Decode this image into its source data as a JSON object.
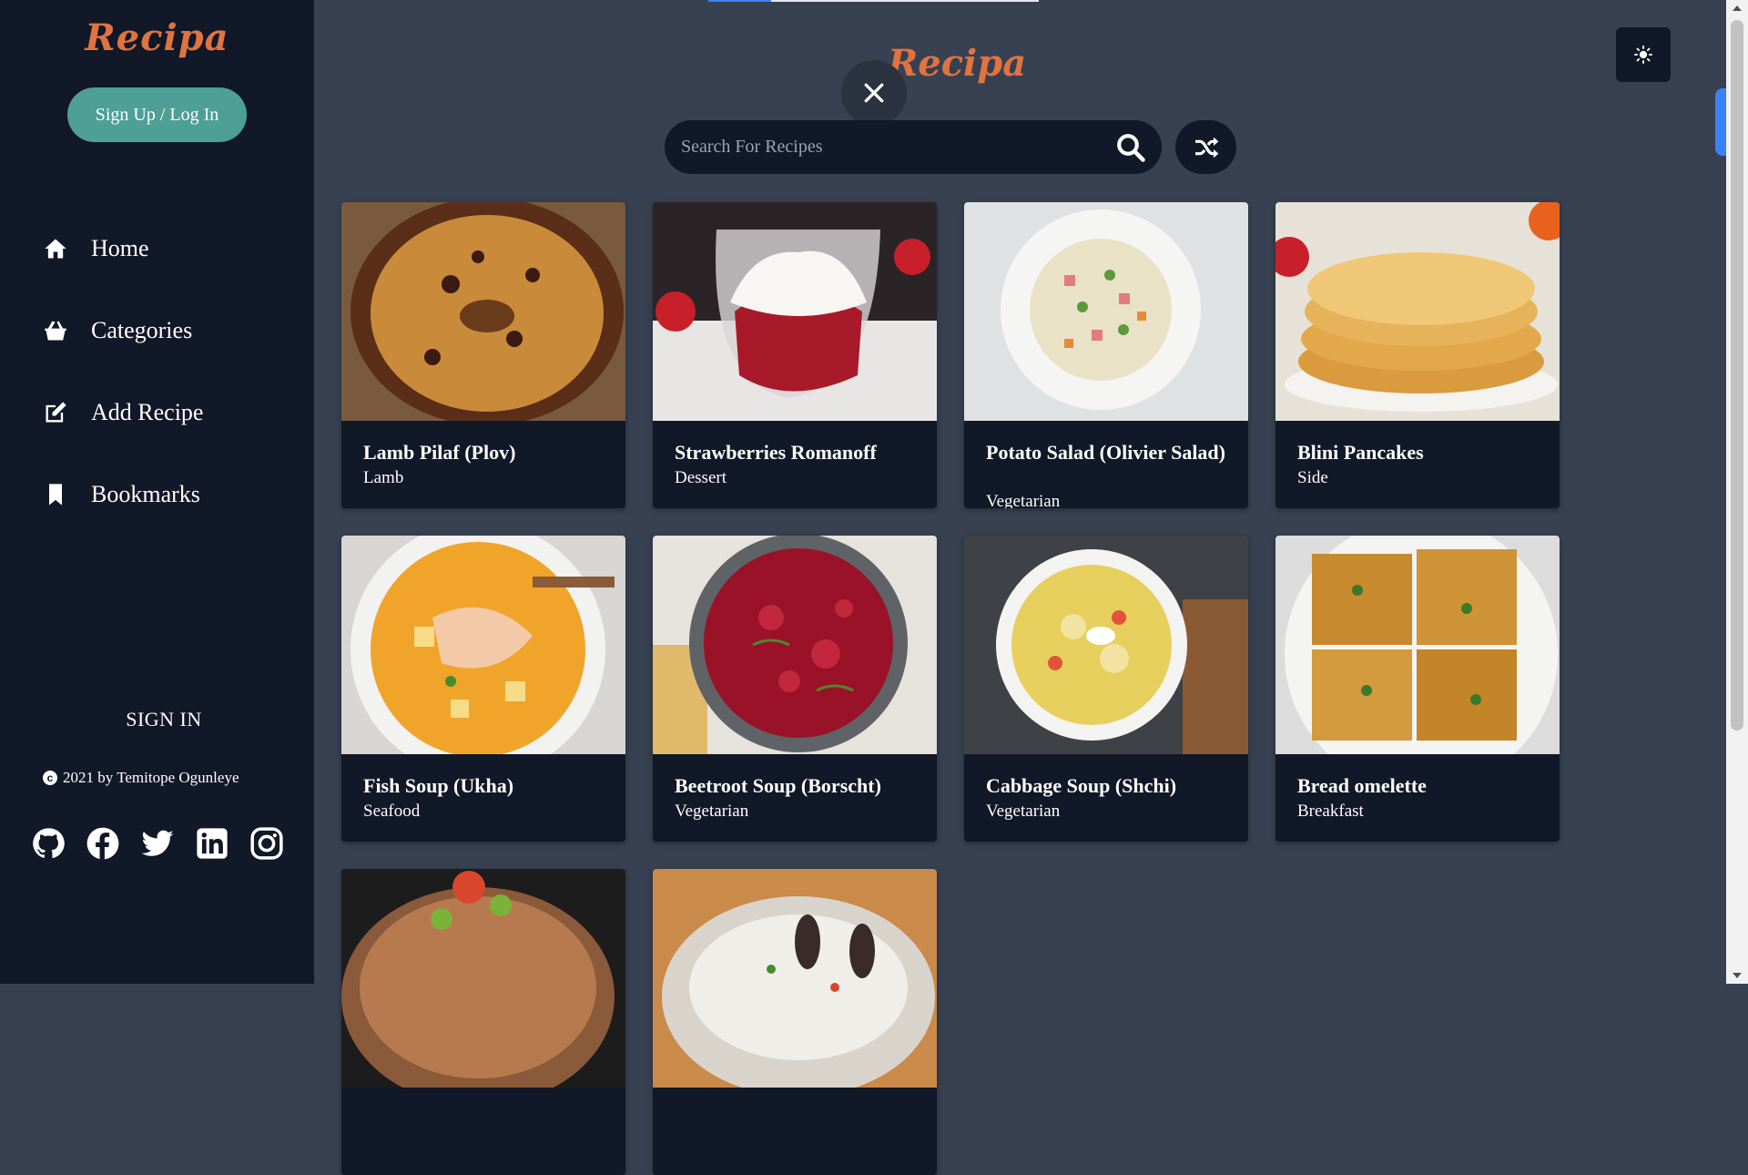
{
  "sidebar": {
    "brand": "Recipa",
    "auth_button": "Sign Up / Log In",
    "nav": [
      {
        "label": "Home",
        "icon": "home-icon"
      },
      {
        "label": "Categories",
        "icon": "basket-icon"
      },
      {
        "label": "Add Recipe",
        "icon": "edit-icon"
      },
      {
        "label": "Bookmarks",
        "icon": "bookmark-icon"
      }
    ],
    "sign_in": "SIGN IN",
    "copyright": "2021 by Temitope Ogunleye",
    "socials": [
      "github-icon",
      "facebook-icon",
      "twitter-icon",
      "linkedin-icon",
      "instagram-icon"
    ]
  },
  "main": {
    "brand": "Recipa",
    "search": {
      "placeholder": "Search For Recipes"
    },
    "loader_progress": 0.19
  },
  "recipes": [
    {
      "title": "Lamb Pilaf (Plov)",
      "category": "Lamb"
    },
    {
      "title": "Strawberries Romanoff",
      "category": "Dessert"
    },
    {
      "title": "Potato Salad (Olivier Salad)",
      "category": "Vegetarian"
    },
    {
      "title": "Blini Pancakes",
      "category": "Side"
    },
    {
      "title": "Fish Soup (Ukha)",
      "category": "Seafood"
    },
    {
      "title": "Beetroot Soup (Borscht)",
      "category": "Vegetarian"
    },
    {
      "title": "Cabbage Soup (Shchi)",
      "category": "Vegetarian"
    },
    {
      "title": "Bread omelette",
      "category": "Breakfast"
    }
  ],
  "colors": {
    "brand": "#e0733f",
    "sidebar_bg": "#111827",
    "main_bg": "#374151",
    "button_teal": "#4e9f96",
    "card_bg": "#111827"
  }
}
